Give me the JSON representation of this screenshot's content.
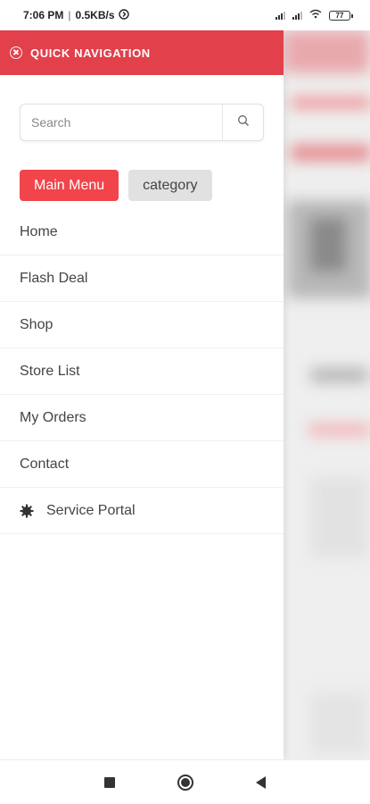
{
  "status_bar": {
    "time": "7:06 PM",
    "speed": "0.5KB/s",
    "battery": "77"
  },
  "drawer": {
    "title": "QUICK NAVIGATION",
    "search": {
      "placeholder": "Search",
      "value": ""
    },
    "tabs": [
      {
        "label": "Main Menu",
        "active": true
      },
      {
        "label": "category",
        "active": false
      }
    ],
    "menu": [
      {
        "label": "Home"
      },
      {
        "label": "Flash Deal"
      },
      {
        "label": "Shop"
      },
      {
        "label": "Store List"
      },
      {
        "label": "My Orders"
      },
      {
        "label": "Contact"
      },
      {
        "label": "Service Portal",
        "icon": "gear-icon"
      }
    ]
  },
  "colors": {
    "header_red": "#e2404a",
    "active_tab_red": "#f1444b",
    "inactive_tab_gray": "#e1e1e1"
  },
  "nav_bar": {
    "buttons": [
      "recents-button",
      "home-button",
      "back-button"
    ]
  }
}
